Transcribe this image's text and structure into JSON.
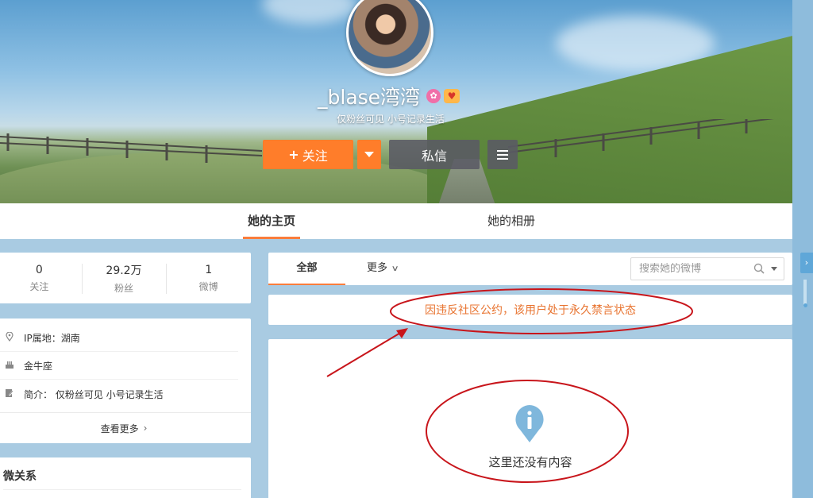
{
  "profile": {
    "username": "_blase湾湾",
    "bio_short": "仅粉丝可见 小号记录生活",
    "vip_icon": "vip-icon",
    "badge_icon": "badge-icon"
  },
  "actions": {
    "follow_plus": "+",
    "follow_label": "关注",
    "message_label": "私信"
  },
  "nav": {
    "tabs": [
      {
        "label": "她的主页",
        "active": true
      },
      {
        "label": "她的相册",
        "active": false
      }
    ]
  },
  "stats": [
    {
      "value": "0",
      "label": "关注"
    },
    {
      "value": "29.2万",
      "label": "粉丝"
    },
    {
      "value": "1",
      "label": "微博"
    }
  ],
  "info": {
    "rows": [
      {
        "icon": "location-icon",
        "text": "IP属地：湖南"
      },
      {
        "icon": "cake-icon",
        "text": "金牛座"
      },
      {
        "icon": "edit-icon",
        "text": "简介： 仅粉丝可见 小号记录生活"
      }
    ],
    "more_label": "查看更多",
    "more_chevron": "›"
  },
  "relations": {
    "title": "微关系"
  },
  "feed": {
    "tab_all": "全部",
    "tab_more": "更多",
    "search_placeholder": "搜索她的微博",
    "notice": "因违反社区公约，该用户处于永久禁言状态",
    "empty_text": "这里还没有内容"
  },
  "colors": {
    "accent_orange": "#ff7d2a",
    "notice_orange": "#e8732f",
    "annotation_red": "#c8151b",
    "page_bg": "#a9cbe2"
  }
}
